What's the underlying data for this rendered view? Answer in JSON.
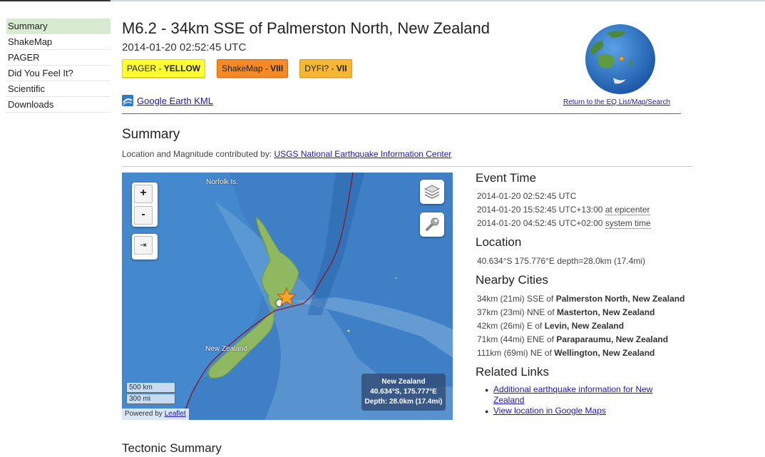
{
  "sidebar": {
    "items": [
      {
        "label": "Summary",
        "active": true
      },
      {
        "label": "ShakeMap"
      },
      {
        "label": "PAGER"
      },
      {
        "label": "Did You Feel It?"
      },
      {
        "label": "Scientific"
      },
      {
        "label": "Downloads"
      }
    ]
  },
  "header": {
    "title": "M6.2 - 34km SSE of Palmerston North, New Zealand",
    "datetime": "2014-01-20 02:52:45 UTC",
    "badges": [
      {
        "prefix": "PAGER - ",
        "value": "YELLOW",
        "color": "#ffff33",
        "border": "#e0d000"
      },
      {
        "prefix": "ShakeMap - ",
        "value": "VIII",
        "color": "#f58a26",
        "border": "#d06a10"
      },
      {
        "prefix": "DYFI? - ",
        "value": "VII",
        "color": "#f7b733",
        "border": "#d89a20"
      }
    ],
    "kml_label": "Google Earth KML",
    "return_link": "Return to the EQ List/Map/Search"
  },
  "summary": {
    "title": "Summary",
    "contrib_prefix": "Location and Magnitude contributed by: ",
    "contrib_link": "USGS National Earthquake Information Center"
  },
  "map": {
    "labels": {
      "norfolk": "Norfolk Is.",
      "nz": "New Zealand"
    },
    "scale": {
      "km": "500 km",
      "mi": "300 mi"
    },
    "info": {
      "region": "New Zealand",
      "coords": "40.634°S, 175.777°E",
      "depth": "Depth: 28.0km (17.4mi)"
    },
    "attribution_prefix": "Powered by ",
    "attribution_link": "Leaflet",
    "zoom_in": "+",
    "zoom_out": "-",
    "fullscreen": "⇥",
    "layers_icon": "layers-icon",
    "tools_icon": "wrench-icon"
  },
  "event_time": {
    "title": "Event Time",
    "utc": "2014-01-20 02:52:45 UTC",
    "epicenter_time": "2014-01-20 15:52:45 UTC+13:00",
    "epicenter_link": "at epicenter",
    "system_time": "2014-01-20 04:52:45 UTC+02:00",
    "system_link": "system time"
  },
  "location": {
    "title": "Location",
    "value": "40.634°S 175.776°E depth=28.0km (17.4mi)"
  },
  "nearby": {
    "title": "Nearby Cities",
    "cities": [
      {
        "dist": "34km (21mi) SSE of ",
        "name": "Palmerston North, New Zealand"
      },
      {
        "dist": "37km (23mi) NNE of ",
        "name": "Masterton, New Zealand"
      },
      {
        "dist": "42km (26mi) E of ",
        "name": "Levin, New Zealand"
      },
      {
        "dist": "71km (44mi) ENE of ",
        "name": "Paraparaumu, New Zealand"
      },
      {
        "dist": "111km (69mi) NE of ",
        "name": "Wellington, New Zealand"
      }
    ]
  },
  "related": {
    "title": "Related Links",
    "links": [
      "Additional earthquake information for New Zealand",
      "View location in Google Maps"
    ]
  },
  "tectonic": {
    "title": "Tectonic Summary"
  },
  "colors": {
    "link": "#1a1aa6",
    "active_bg": "#d6ebd0",
    "ocean": "#3e7fc6",
    "land": "#8fb860"
  }
}
